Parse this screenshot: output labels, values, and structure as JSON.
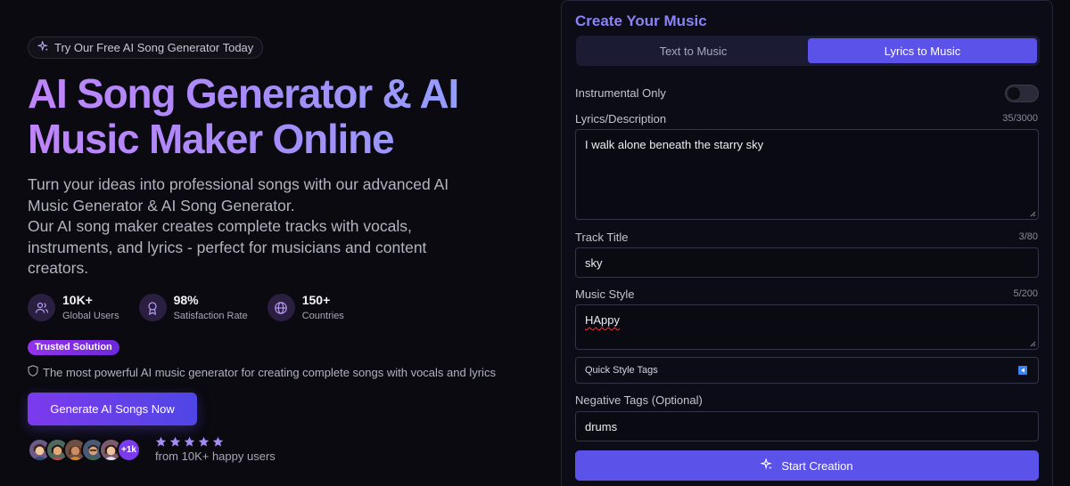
{
  "hero": {
    "pill_text": "Try Our Free AI Song Generator Today",
    "title": "AI Song Generator & AI Music Maker Online",
    "description_lines": [
      "Turn your ideas into professional songs with our advanced AI Music Generator & AI Song Generator.",
      "Our AI song maker creates complete tracks with vocals, instruments, and lyrics - perfect for musicians and content creators."
    ],
    "stats": [
      {
        "value": "10K+",
        "label": "Global Users",
        "icon": "users-icon"
      },
      {
        "value": "98%",
        "label": "Satisfaction Rate",
        "icon": "award-icon"
      },
      {
        "value": "150+",
        "label": "Countries",
        "icon": "globe-icon"
      }
    ],
    "badge": "Trusted Solution",
    "tagline": "The most powerful AI music generator for creating complete songs with vocals and lyrics",
    "cta_label": "Generate AI Songs Now",
    "avatar_more": "+1k",
    "rating_stars": 5,
    "rating_text": "from 10K+ happy users"
  },
  "form": {
    "title": "Create Your Music",
    "tabs": [
      {
        "label": "Text to Music",
        "active": false
      },
      {
        "label": "Lyrics to Music",
        "active": true
      }
    ],
    "instrumental_label": "Instrumental Only",
    "instrumental_on": false,
    "lyrics_label": "Lyrics/Description",
    "lyrics_counter": "35/3000",
    "lyrics_value": "I walk alone beneath the starry sky",
    "track_title_label": "Track Title",
    "track_title_counter": "3/80",
    "track_title_value": "sky",
    "music_style_label": "Music Style",
    "music_style_counter": "5/200",
    "music_style_value": "HAppy",
    "quick_style_tags_label": "Quick Style Tags",
    "negative_tags_label": "Negative Tags (Optional)",
    "negative_tags_value": "drums",
    "submit_label": "Start Creation"
  },
  "colors": {
    "accent": "#5b52ea",
    "title_gradient_start": "#c084fc",
    "title_gradient_end": "#8ba6ff",
    "panel_title": "#8b83f5",
    "star": "#a78bfa"
  }
}
